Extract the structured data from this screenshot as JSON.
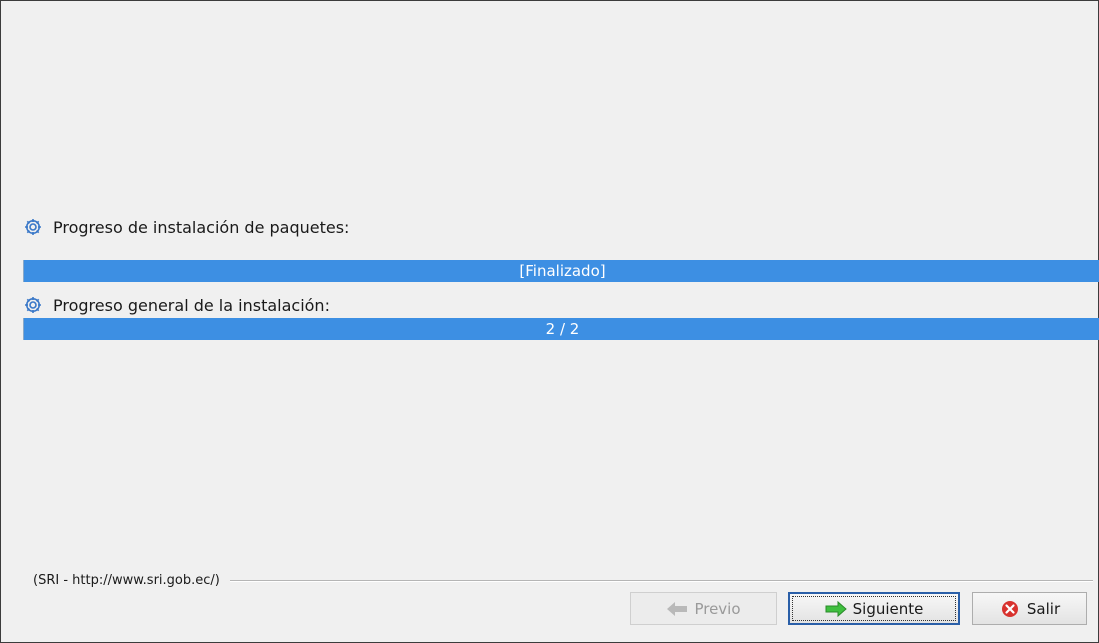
{
  "packages_progress": {
    "label": "Progreso de instalación de paquetes:",
    "bar_text": "[Finalizado]",
    "fraction": 1.0
  },
  "overall_progress": {
    "label": "Progreso general de la instalación:",
    "bar_text": "2 / 2",
    "fraction": 1.0
  },
  "footer": {
    "credit": "(SRI - http://www.sri.gob.ec/)"
  },
  "buttons": {
    "previous": "Previo",
    "next": "Siguiente",
    "exit": "Salir"
  },
  "colors": {
    "progress": "#3d8fe3",
    "next_icon": "#3fbf3f",
    "exit_icon": "#d8322e",
    "gear_icon": "#3a78c8"
  },
  "icons": {
    "section": "gear-icon",
    "previous": "arrow-left-icon",
    "next": "arrow-right-icon",
    "exit": "close-circle-icon"
  }
}
